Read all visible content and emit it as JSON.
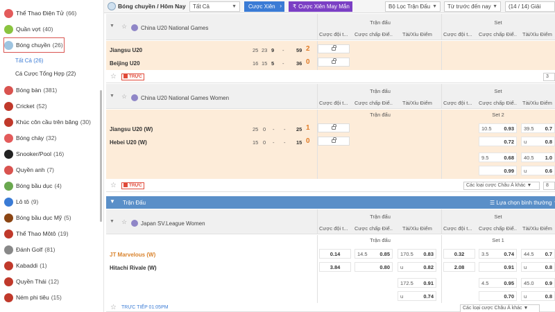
{
  "sidebar": {
    "items": [
      {
        "label": "Thể Thao Điện Tử",
        "count": "(66)",
        "color": "#e35b5b"
      },
      {
        "label": "Quần vợt",
        "count": "(40)",
        "color": "#8ac43f"
      },
      {
        "label": "Bóng chuyền",
        "count": "(26)",
        "color": "#9ec4e0"
      },
      {
        "label": "Bóng bàn",
        "count": "(381)",
        "color": "#d9534f"
      },
      {
        "label": "Cricket",
        "count": "(52)",
        "color": "#c0392b"
      },
      {
        "label": "Khúc côn cầu trên băng",
        "count": "(30)",
        "color": "#c0392b"
      },
      {
        "label": "Bóng chày",
        "count": "(32)",
        "color": "#e35b5b"
      },
      {
        "label": "Snooker/Pool",
        "count": "(16)",
        "color": "#222222"
      },
      {
        "label": "Quyền anh",
        "count": "(7)",
        "color": "#d9534f"
      },
      {
        "label": "Bóng bầu dục",
        "count": "(4)",
        "color": "#6aa84f"
      },
      {
        "label": "Lô tô",
        "count": "(9)",
        "color": "#3a7bd5"
      },
      {
        "label": "Bóng bầu dục Mỹ",
        "count": "(5)",
        "color": "#8b4513"
      },
      {
        "label": "Thể Thao Môtô",
        "count": "(19)",
        "color": "#c0392b"
      },
      {
        "label": "Đánh Golf",
        "count": "(81)",
        "color": "#888888"
      },
      {
        "label": "Kabaddi",
        "count": "(1)",
        "color": "#c0392b"
      },
      {
        "label": "Quyền Thái",
        "count": "(12)",
        "color": "#c0392b"
      },
      {
        "label": "Ném phi tiêu",
        "count": "(15)",
        "color": "#c0392b"
      }
    ],
    "sub_items": [
      {
        "label": "Tất Cả (26)"
      },
      {
        "label": "Cá Cược Tổng Hợp",
        "count": "(22)"
      }
    ]
  },
  "topbar": {
    "title": "Bóng chuyền / Hôm Nay",
    "filter_select": "Tất Cả",
    "parlay_button": "Cược Xiên",
    "lucky_parlay_button": "Cược Xiên May Mắn",
    "league_filter": "Bộ Lọc Trận Đấu",
    "sort_select": "Từ trước đến nay",
    "count_label": "(14 / 14) Giải"
  },
  "headers": {
    "match": "Trận đấu",
    "set": "Set",
    "col_winner": "Cược đội t...",
    "col_handicap": "Cược chấp Điể...",
    "col_ou": "Tài/Xỉu Điểm"
  },
  "leagues": [
    {
      "name": "China U20 National Games",
      "matches": [
        {
          "team": "Jiangsu U20",
          "s1": "25",
          "s2": "23",
          "s3": "9",
          "s4": "-",
          "pts": "59",
          "sets": "2"
        },
        {
          "team": "Beijing U20",
          "s1": "16",
          "s2": "15",
          "s3": "5",
          "s4": "-",
          "pts": "36",
          "sets": "0"
        }
      ],
      "live": "TRỰC",
      "select_small": "3"
    },
    {
      "name": "China U20 National Games Women",
      "sublabel_match": "Trận đấu",
      "sublabel_set": "Set 2",
      "matches": [
        {
          "team": "Jiangsu U20 (W)",
          "s1": "25",
          "s2": "0",
          "s3": "-",
          "s4": "-",
          "pts": "25",
          "sets": "1"
        },
        {
          "team": "Hebei U20 (W)",
          "s1": "15",
          "s2": "0",
          "s3": "-",
          "s4": "-",
          "pts": "15",
          "sets": "0"
        }
      ],
      "odds": {
        "r1_h": "10.5",
        "r1_v": "0.93",
        "r1_h2": "39.5",
        "r1_v2": "0.7",
        "r2_v": "0.72",
        "r2_h2": "u",
        "r2_v2": "0.8",
        "r3_h": "9.5",
        "r3_v": "0.68",
        "r3_h2": "40.5",
        "r3_v2": "1.0",
        "r4_v": "0.99",
        "r4_h2": "u",
        "r4_v2": "0.6"
      },
      "live": "TRỰC",
      "market_select": "Các loại cược Châu Á khác",
      "select_small": "8"
    }
  ],
  "section_bar": {
    "label": "Trận Đấu",
    "right": "Lựa chọn bình thường"
  },
  "league3": {
    "name": "Japan SV.League Women",
    "sublabel_match": "Trận đấu",
    "sublabel_set": "Set 1",
    "teams": [
      "JT Marvelous (W)",
      "Hitachi Rivale (W)"
    ],
    "odds": {
      "w1": "0.14",
      "h1": "14.5",
      "hv1": "0.85",
      "ou1": "170.5",
      "ouv1": "0.83",
      "sw1": "0.32",
      "sh1": "3.5",
      "shv1": "0.74",
      "sou1": "44.5",
      "souv1": "0.7",
      "w2": "3.84",
      "hv2": "0.80",
      "ou2": "u",
      "ouv2": "0.82",
      "sw2": "2.08",
      "shv2": "0.91",
      "sou2": "u",
      "souv2": "0.8",
      "ou3": "172.5",
      "ouv3": "0.91",
      "sh3": "4.5",
      "shv3": "0.95",
      "sou3": "45.0",
      "souv3": "0.9",
      "ou4": "u",
      "ouv4": "0.74",
      "shv4": "0.70",
      "sou4": "u",
      "souv4": "0.8"
    },
    "footer_text": "TRỰC TIẾP  01:05PM",
    "market_select": "Các loại cược Châu Á khác"
  }
}
